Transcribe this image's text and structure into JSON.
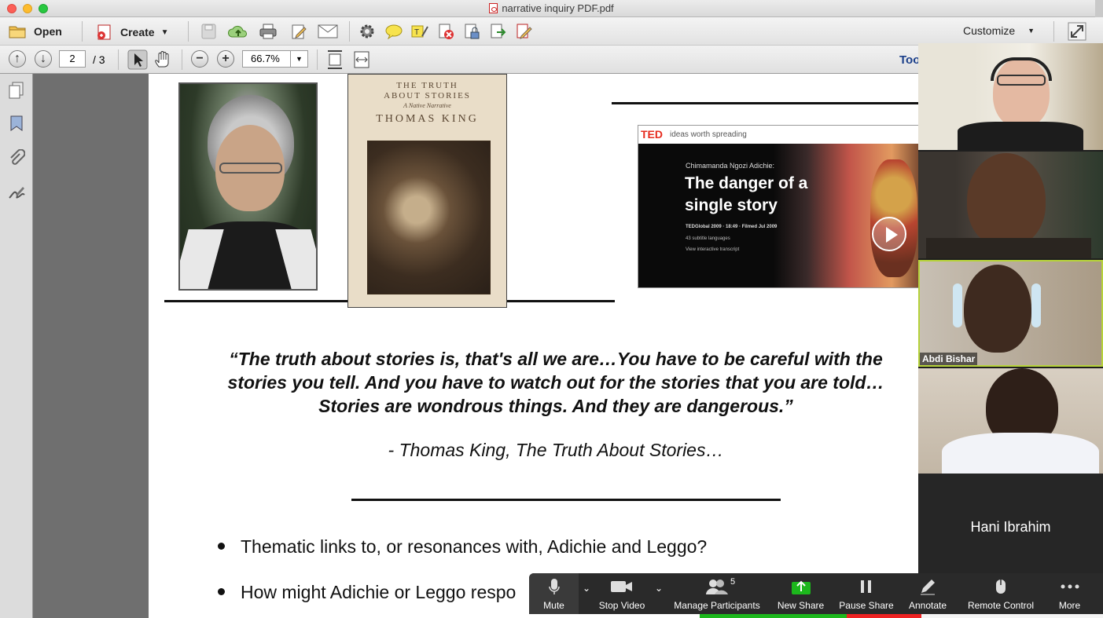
{
  "window": {
    "title": "narrative inquiry PDF.pdf"
  },
  "toolbar1": {
    "open_label": "Open",
    "create_label": "Create",
    "customize_label": "Customize"
  },
  "toolbar2": {
    "page_current": "2",
    "page_total": "/ 3",
    "zoom_value": "66.7%",
    "tools_label": "Too"
  },
  "pdf_page": {
    "book": {
      "title_line1": "THE TRUTH",
      "title_line2": "ABOUT STORIES",
      "subtitle": "A Native Narrative",
      "author": "THOMAS KING"
    },
    "ted": {
      "brand": "TED",
      "tagline": "ideas worth spreading",
      "speaker": "Chimamanda Ngozi Adichie:",
      "talk_line1": "The danger of a",
      "talk_line2": "single story",
      "meta": "TEDGlobal 2009 · 18:49 · Filmed Jul 2009",
      "subtitles": "43 subtitle languages",
      "transcript": "View interactive transcript"
    },
    "quote": "“The truth about stories is, that's all we are…You have to be careful with the stories you tell. And you have to watch out for the stories that you are told… Stories are wondrous things. And they are dangerous.”",
    "attribution": "- Thomas King, The Truth About Stories…",
    "bullets": [
      "Thematic links to, or resonances with, Adichie and Leggo?",
      "How might Adichie or Leggo respo"
    ]
  },
  "zoom": {
    "participants": [
      {
        "name": ""
      },
      {
        "name": ""
      },
      {
        "name": "Abdi Bishar"
      },
      {
        "name": ""
      },
      {
        "name": "Hani Ibrahim"
      }
    ],
    "controls": {
      "mute": "Mute",
      "stop_video": "Stop Video",
      "manage_participants": "Manage Participants",
      "participant_count": "5",
      "new_share": "New Share",
      "pause_share": "Pause Share",
      "annotate": "Annotate",
      "remote_control": "Remote Control",
      "more": "More"
    }
  },
  "colors": {
    "zoom_green": "#1cb71c",
    "zoom_red": "#e22222",
    "ted_red": "#e62b1e",
    "active_speaker": "#b6d33a"
  }
}
